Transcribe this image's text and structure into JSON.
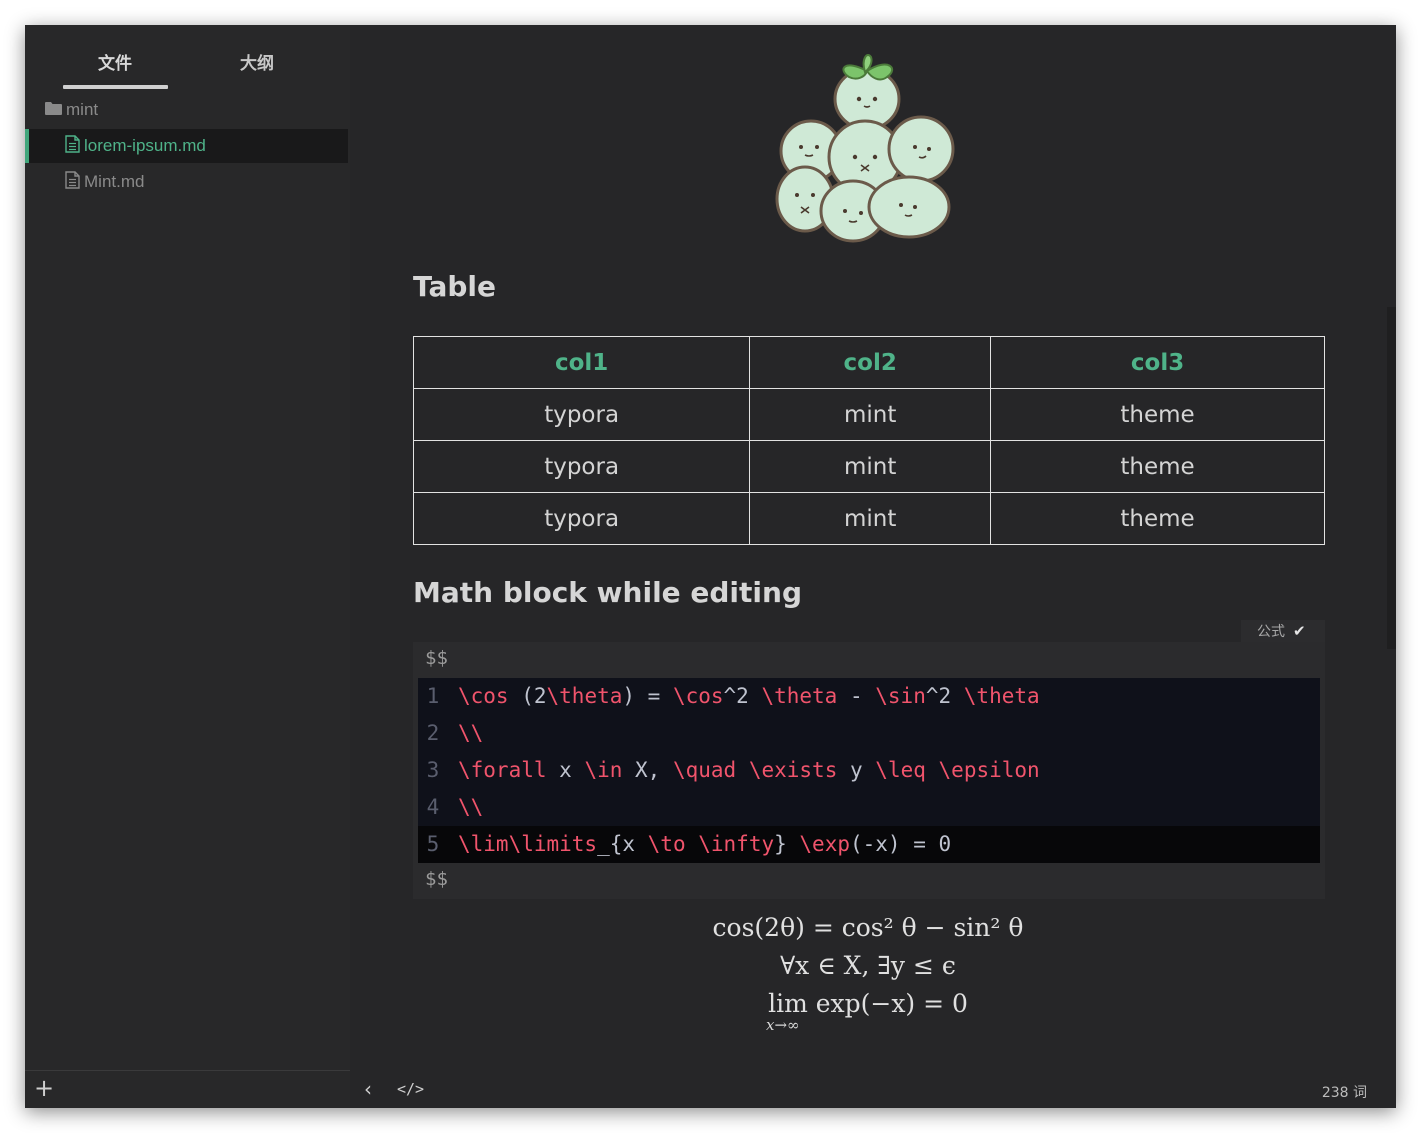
{
  "sidebar": {
    "tabs": [
      {
        "label": "文件",
        "active": true
      },
      {
        "label": "大纲",
        "active": false
      }
    ],
    "folder": {
      "name": "mint",
      "icon": "folder-icon"
    },
    "files": [
      {
        "name": "lorem-ipsum.md",
        "icon": "file-icon",
        "active": true
      },
      {
        "name": "Mint.md",
        "icon": "file-icon",
        "active": false
      }
    ],
    "add_label": "+"
  },
  "editor": {
    "image_alt": "mint mascot pile",
    "table_heading": "Table",
    "table": {
      "headers": [
        "col1",
        "col2",
        "col3"
      ],
      "rows": [
        [
          "typora",
          "mint",
          "theme"
        ],
        [
          "typora",
          "mint",
          "theme"
        ],
        [
          "typora",
          "mint",
          "theme"
        ]
      ]
    },
    "math_heading": "Math block while editing",
    "math_label": "公式",
    "math_check": "✔",
    "math_delim": "$$",
    "code_lines": [
      {
        "num": "1",
        "text": "\\cos (2\\theta) = \\cos^2 \\theta - \\sin^2 \\theta"
      },
      {
        "num": "2",
        "text": "\\\\"
      },
      {
        "num": "3",
        "text": "\\forall x \\in X, \\quad \\exists y \\leq \\epsilon"
      },
      {
        "num": "4",
        "text": "\\\\"
      },
      {
        "num": "5",
        "text": "\\lim\\limits_{x \\to \\infty} \\exp(-x) = 0"
      }
    ],
    "rendered": {
      "line1": "cos(2θ) = cos² θ − sin² θ",
      "line2": "∀x ∈ X,    ∃y ≤ ϵ",
      "line3": "lim exp(−x) = 0",
      "line3_sub": "x→∞"
    }
  },
  "footer": {
    "back": "‹",
    "code_toggle": "</>",
    "word_count": "238 词"
  },
  "colors": {
    "accent": "#4fb389",
    "keyword": "#f0546c",
    "background": "#262628"
  }
}
